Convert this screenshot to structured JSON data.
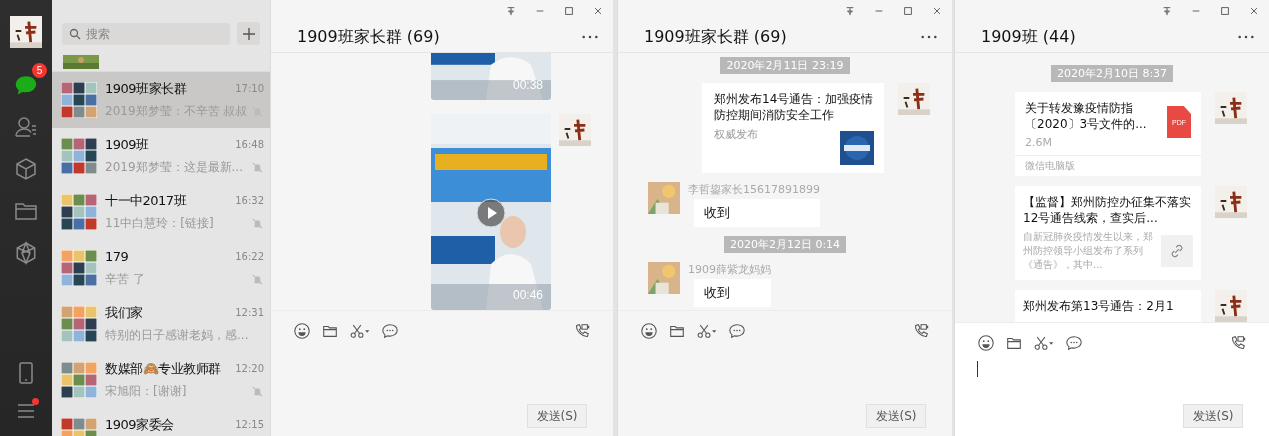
{
  "nav": {
    "items": [
      {
        "kind": "chats",
        "selected": true,
        "badge": "5"
      },
      {
        "kind": "contacts",
        "selected": false
      },
      {
        "kind": "favorites",
        "selected": false
      },
      {
        "kind": "files",
        "selected": false
      },
      {
        "kind": "moments",
        "selected": false
      }
    ],
    "bottom": [
      {
        "kind": "phone",
        "dot": false
      },
      {
        "kind": "menu",
        "dot": true
      }
    ]
  },
  "chat_list": {
    "search": {
      "placeholder": "搜索"
    },
    "chats": [
      {
        "name": "1909班家长群",
        "preview": "2019郑梦莹：不辛苦 叔叔",
        "time": "17:10",
        "muted": true,
        "selected": true
      },
      {
        "name": "1909班",
        "preview": "2019郑梦莹：这是最新...",
        "time": "16:48",
        "muted": true,
        "selected": false
      },
      {
        "name": "十一中2017班",
        "preview": "11中白慧玲：[链接]",
        "time": "16:32",
        "muted": true,
        "selected": false
      },
      {
        "name": "179",
        "preview": "辛苦 了",
        "time": "16:22",
        "muted": true,
        "selected": false
      },
      {
        "name": "我们家",
        "preview": "特别的日子感谢老妈，感...",
        "time": "12:31",
        "muted": false,
        "selected": false
      },
      {
        "name": "数媒部🙈专业教师群",
        "preview": "宋旭阳：[谢谢]",
        "time": "12:20",
        "muted": true,
        "selected": false
      },
      {
        "name": "1909家委会",
        "time": "12:15",
        "muted": false,
        "selected": false
      }
    ]
  },
  "windows": [
    {
      "title": "1909班家长群 (69)",
      "input_focused": false,
      "send": "发送(S)",
      "messages": [
        {
          "kind": "video",
          "from_me": true,
          "duration": "00:38",
          "play": false,
          "cut_off": true
        },
        {
          "kind": "video",
          "from_me": true,
          "duration": "00:46",
          "play": true,
          "cut_off": false
        }
      ]
    },
    {
      "title": "1909班家长群 (69)",
      "input_focused": false,
      "send": "发送(S)",
      "messages": [
        {
          "kind": "time",
          "text": "2020年2月11日 23:19"
        },
        {
          "kind": "link_card",
          "from_me": true,
          "title": "郑州发布14号通告：加强疫情防控期间消防安全工作",
          "source": "权威发布"
        },
        {
          "kind": "text",
          "from_me": false,
          "sender": "李哲鋆家长15617891899",
          "text": "收到"
        },
        {
          "kind": "time",
          "text": "2020年2月12日 0:14"
        },
        {
          "kind": "text",
          "from_me": false,
          "sender": "1909薛紫龙妈妈",
          "text": "收到"
        }
      ]
    },
    {
      "title": "1909班 (44)",
      "input_focused": true,
      "send": "发送(S)",
      "messages": [
        {
          "kind": "time",
          "text": "2020年2月10日 8:37"
        },
        {
          "kind": "file_card",
          "from_me": true,
          "title": "关于转发豫疫情防指〔2020〕3号文件的...",
          "size": "2.6M",
          "file_type": "PDF",
          "footer": "微信电脑版"
        },
        {
          "kind": "article_card",
          "from_me": true,
          "title": "【监督】郑州防控办征集不落实12号通告线索，查实后...",
          "description": "自新冠肺炎疫情发生以来，郑州防控领导小组发布了系列《通告》，其中..."
        },
        {
          "kind": "article_card",
          "from_me": true,
          "title": "郑州发布第13号通告：2月1"
        }
      ]
    }
  ]
}
